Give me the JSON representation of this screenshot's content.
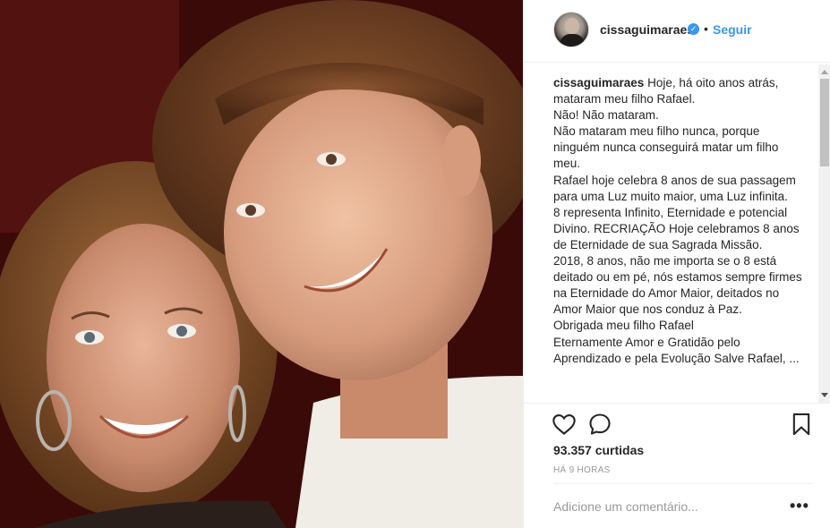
{
  "post": {
    "photo_alt": "",
    "header": {
      "username": "cissaguimaraes",
      "verified_icon": "verified-badge-icon",
      "separator": "•",
      "follow_label": "Seguir"
    },
    "caption": {
      "username": "cissaguimaraes",
      "text": "Hoje, há oito anos atrás, mataram meu filho Rafael.\nNão! Não mataram.\nNão mataram meu filho nunca, porque ninguém nunca conseguirá matar um filho meu.\nRafael hoje celebra 8 anos de sua passagem para uma Luz muito maior, uma Luz infinita.\n8 representa Infinito, Eternidade e potencial Divino. RECRIAÇÃO Hoje celebramos 8 anos de Eternidade de sua Sagrada Missão.\n2018, 8 anos, não me importa se o 8 está deitado ou em pé, nós estamos sempre firmes na Eternidade do Amor Maior, deitados no Amor Maior que nos conduz à Paz.\nObrigada meu filho Rafael\nEternamente Amor e Gratidão pelo Aprendizado e pela Evolução Salve Rafael, ..."
    },
    "actions": {
      "like_icon": "heart-icon",
      "comment_icon": "comment-icon",
      "save_icon": "bookmark-icon"
    },
    "likes": "93.357 curtidas",
    "time": "HÁ 9 HORAS",
    "comment": {
      "placeholder": "Adicione um comentário...",
      "more_label": "•••"
    }
  },
  "colors": {
    "accent": "#3897f0",
    "text": "#262626",
    "muted": "#999999",
    "border": "#efefef"
  }
}
